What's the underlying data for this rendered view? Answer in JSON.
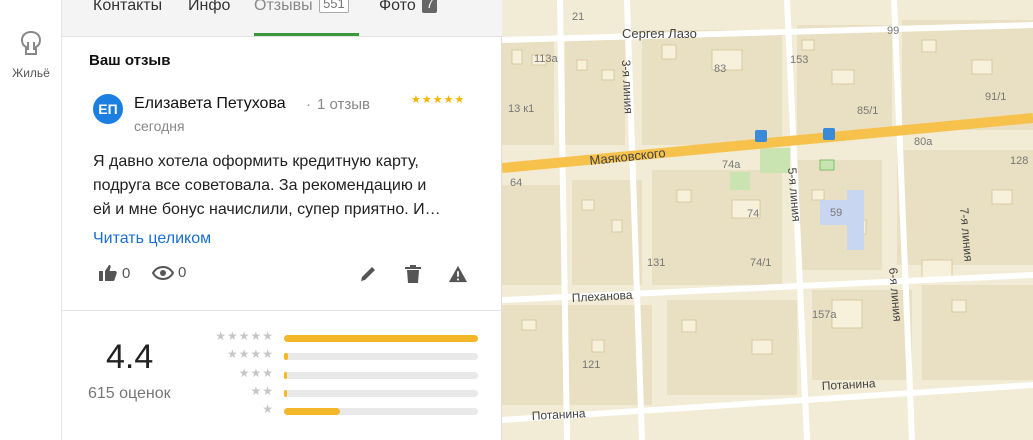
{
  "rail": {
    "housing_label": "Жильё"
  },
  "tabs": [
    {
      "label": "Контакты"
    },
    {
      "label": "Инфо"
    },
    {
      "label": "Отзывы",
      "count": "551"
    },
    {
      "label": "Фото",
      "count": "7"
    }
  ],
  "review": {
    "section_title": "Ваш отзыв",
    "avatar_initials": "ЕП",
    "author": "Елизавета Петухова",
    "author_reviews": "1 отзыв",
    "stars": "★★★★★",
    "date": "сегодня",
    "text_line1": "Я давно хотела оформить кредитную карту,",
    "text_line2": "подруга все советовала. За рекомендацию и",
    "text_line3": "ей и мне бонус начислили, супер приятно. И…",
    "read_more": "Читать целиком",
    "likes": "0",
    "views": "0"
  },
  "summary": {
    "rating": "4.4",
    "count_label": "615 оценок",
    "distribution": [
      {
        "stars": "★★★★★",
        "fraction": 1.0
      },
      {
        "stars": "★★★★",
        "fraction": 0.02
      },
      {
        "stars": "★★★",
        "fraction": 0.01
      },
      {
        "stars": "★★",
        "fraction": 0.01
      },
      {
        "stars": "★",
        "fraction": 0.29
      }
    ]
  },
  "map": {
    "streets": {
      "lazo": "Сергея Лазо",
      "mayakovsky": "Маяковского",
      "plekhanova": "Плеханова",
      "potanina_right": "Потанина",
      "potanina_left": "Потанина",
      "line3": "3-я линия",
      "line5": "5-я линия",
      "line6": "6-я линия",
      "line7": "7-я линия"
    },
    "numbers": {
      "n21": "21",
      "n99": "99",
      "n113a": "113а",
      "n83": "83",
      "n153": "153",
      "n13k1": "13 к1",
      "n85_1": "85/1",
      "n91_1": "91/1",
      "n80a": "80а",
      "n128": "128",
      "n74a": "74а",
      "n64": "64",
      "n74": "74",
      "n59": "59",
      "n131": "131",
      "n74_1": "74/1",
      "n157a": "157а",
      "n121": "121"
    },
    "colors": {
      "road_major": "#f7c24b",
      "block": "#e8ddbd",
      "building": "#f6efd8",
      "green": "#c9e4b0",
      "blue": "#c9d6f2"
    }
  }
}
